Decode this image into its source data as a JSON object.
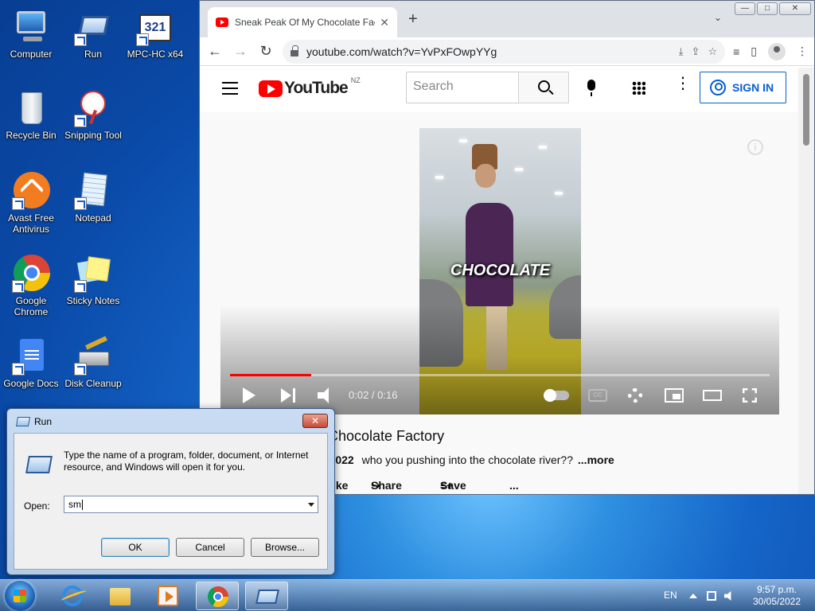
{
  "desktop": {
    "icons": [
      {
        "label": "Computer"
      },
      {
        "label": "Run"
      },
      {
        "label": "MPC-HC x64"
      },
      {
        "label": "Recycle Bin"
      },
      {
        "label": "Snipping Tool"
      },
      {
        "label": "Avast Free Antivirus"
      },
      {
        "label": "Notepad"
      },
      {
        "label": "Google Chrome"
      },
      {
        "label": "Sticky Notes"
      },
      {
        "label": "Google Docs"
      },
      {
        "label": "Disk Cleanup"
      }
    ]
  },
  "browser": {
    "tab_title": "Sneak Peak Of My Chocolate Fac",
    "tab_close": "✕",
    "new_tab": "+",
    "tab_search": "⌄",
    "window_buttons": {
      "minimize": "—",
      "maximize": "□",
      "close": "✕"
    },
    "nav": {
      "back": "←",
      "forward": "→",
      "reload": "↻"
    },
    "url": "youtube.com/watch?v=YvPxFOwpYYg"
  },
  "youtube": {
    "logo_text": "YouTube",
    "region": "NZ",
    "search_placeholder": "Search",
    "sign_in": "SIGN IN",
    "info": "i",
    "video": {
      "caption": "CHOCOLATE",
      "time": "0:02 / 0:16",
      "progress": 0.15,
      "cc": "CC"
    },
    "title": "y Chocolate Factory",
    "date": "3, 2022",
    "description": "who you pushing into the chocolate river??",
    "more": "...more",
    "actions": {
      "like": "ike",
      "share": "Share",
      "save": "Save",
      "more": "..."
    }
  },
  "run_dialog": {
    "title": "Run",
    "close": "✕",
    "description": "Type the name of a program, folder, document, or Internet resource, and Windows will open it for you.",
    "open_label": "Open:",
    "open_value": "sm",
    "ok": "OK",
    "cancel": "Cancel",
    "browse": "Browse..."
  },
  "taskbar": {
    "language": "EN",
    "time": "9:57 p.m.",
    "date": "30/05/2022"
  }
}
